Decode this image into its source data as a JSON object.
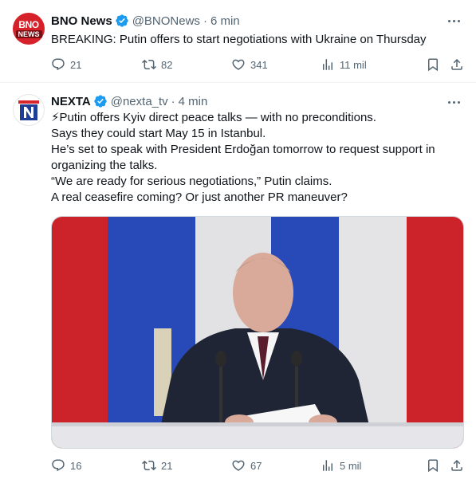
{
  "tweets": [
    {
      "author": {
        "name": "BNO News",
        "handle": "@BNONews",
        "avatar_line1": "BNO",
        "avatar_line2": "NEWS"
      },
      "separator": "·",
      "time": "6 min",
      "text_lines": [
        "BREAKING: Putin offers to start negotiations with Ukraine on Thursday"
      ],
      "stats": {
        "replies": "21",
        "reposts": "82",
        "likes": "341",
        "views": "11 mil"
      }
    },
    {
      "author": {
        "name": "NEXTA",
        "handle": "@nexta_tv"
      },
      "separator": "·",
      "time": "4 min",
      "text_lines": [
        "⚡Putin offers Kyiv direct peace talks — with no preconditions.",
        "Says they could start May 15 in Istanbul.",
        "He’s set to speak with President Erdoğan tomorrow to request support in",
        "organizing the talks.",
        "“We are ready for serious negotiations,” Putin claims.",
        "A real ceasefire coming? Or just another PR maneuver?"
      ],
      "media": {
        "description_icon": "video-still",
        "flag_colors": [
          "#ffffff",
          "#2a4fc4",
          "#d8262c"
        ]
      },
      "stats": {
        "replies": "16",
        "reposts": "21",
        "likes": "67",
        "views": "5 mil"
      }
    }
  ],
  "icons": {
    "reply": "reply-icon",
    "repost": "repost-icon",
    "like": "like-icon",
    "views": "views-icon",
    "bookmark": "bookmark-icon",
    "share": "share-icon",
    "verified": "verified-badge-icon",
    "more": "more-icon"
  },
  "colors": {
    "verified": "#1d9bf0",
    "muted": "#536471",
    "text": "#0f1419",
    "divider": "#eff3f4"
  }
}
